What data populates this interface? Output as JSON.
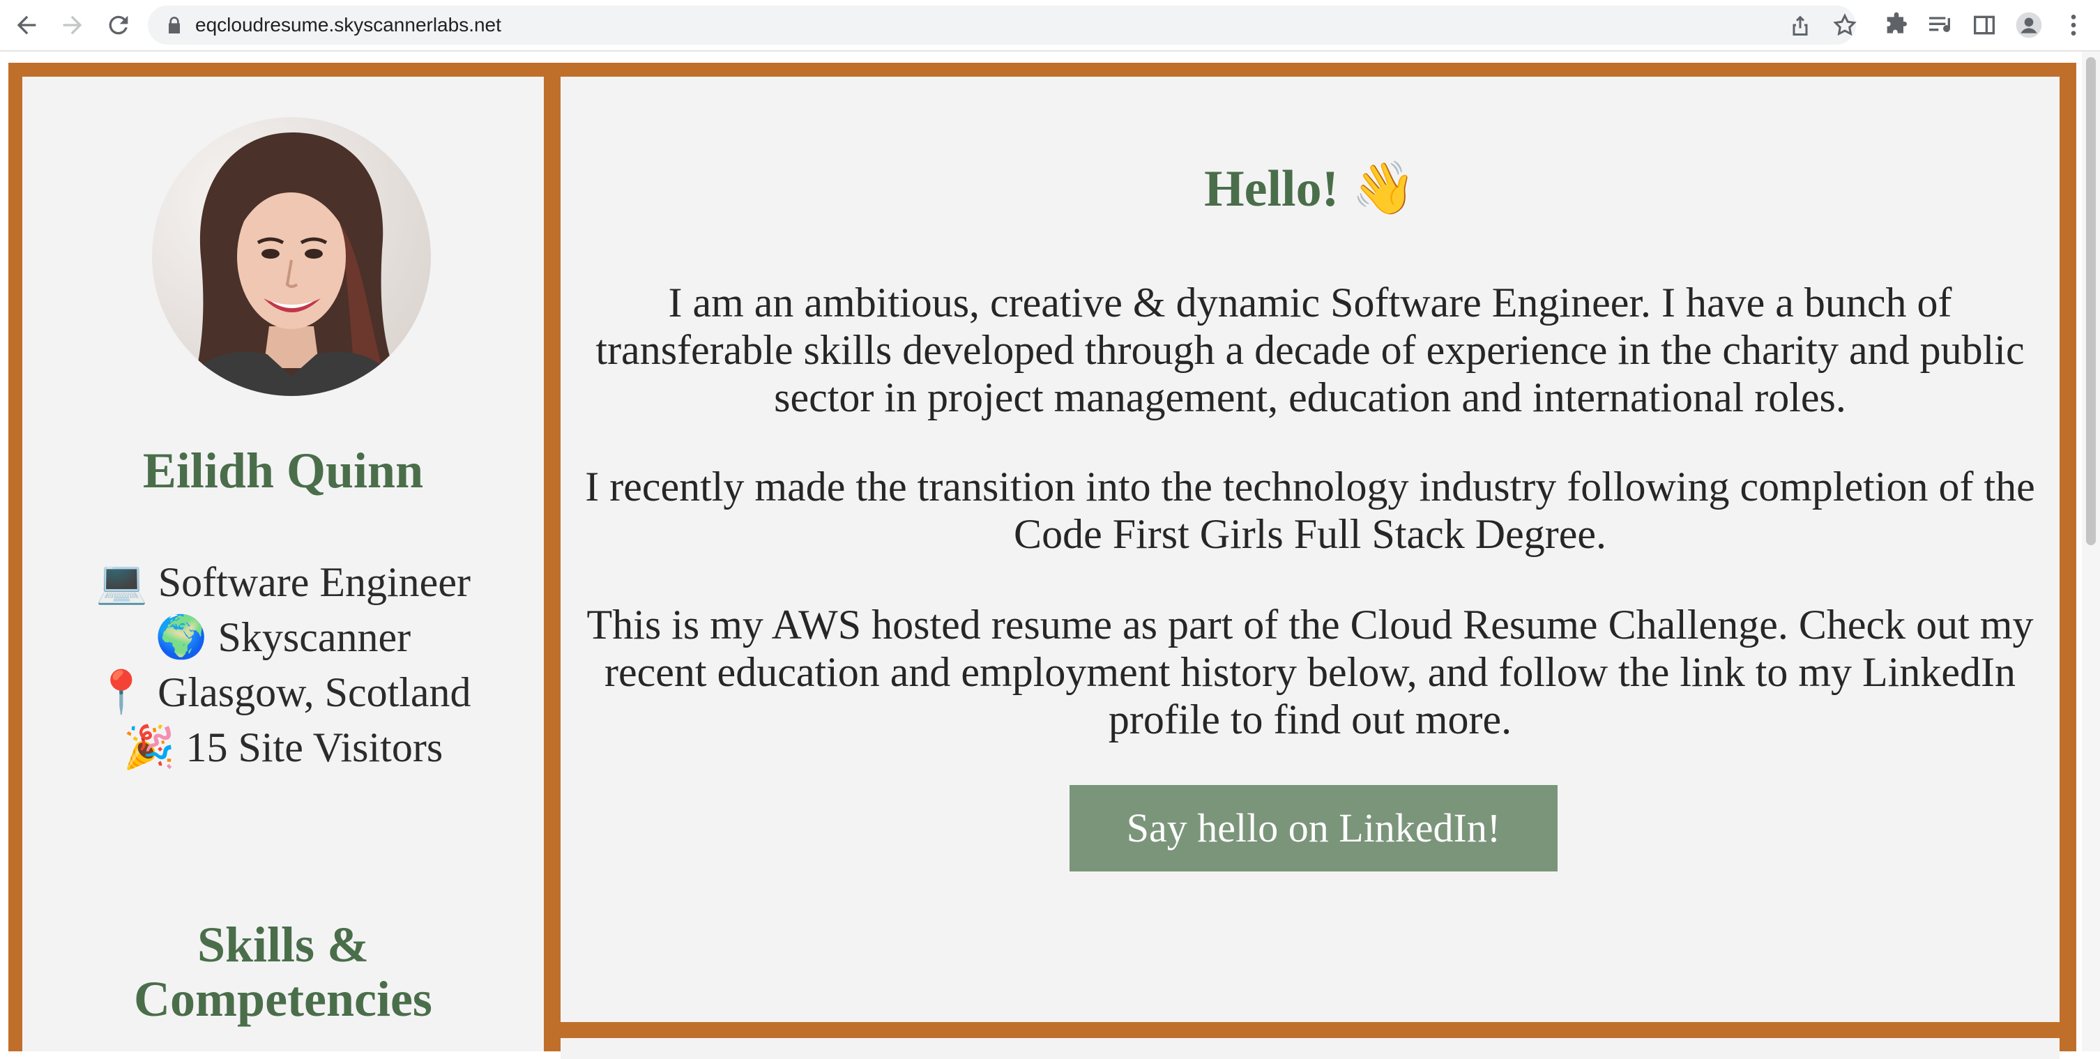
{
  "browser": {
    "url": "eqcloudresume.skyscannerlabs.net",
    "icons": [
      "back-icon",
      "forward-icon",
      "reload-icon",
      "lock-icon",
      "share-icon",
      "star-icon",
      "extensions-icon",
      "reading-list-icon",
      "side-panel-icon",
      "profile-icon",
      "menu-icon"
    ]
  },
  "profile": {
    "name": "Eilidh Quinn",
    "role": "💻 Software Engineer",
    "company": "🌍 Skyscanner",
    "location": "📍 Glasgow, Scotland",
    "visitors": "🎉 15 Site Visitors",
    "skills_line1": "Skills &",
    "skills_line2": "Competencies"
  },
  "intro": {
    "heading": "Hello! 👋",
    "p1": "I am an ambitious, creative & dynamic Software Engineer. I have a bunch of transferable skills developed through a decade of experience in the charity and public sector in project management, education and international roles.",
    "p2": "I recently made the transition into the technology industry following completion of the Code First Girls Full Stack Degree.",
    "p3": "This is my AWS hosted resume as part of the Cloud Resume Challenge. Check out my recent education and employment history below, and follow the link to my LinkedIn profile to find out more.",
    "cta": "Say hello on LinkedIn!"
  },
  "colors": {
    "border": "#c06f2a",
    "panel": "#f3f3f4",
    "heading_green": "#4a6e4a",
    "button": "#7b957b"
  }
}
